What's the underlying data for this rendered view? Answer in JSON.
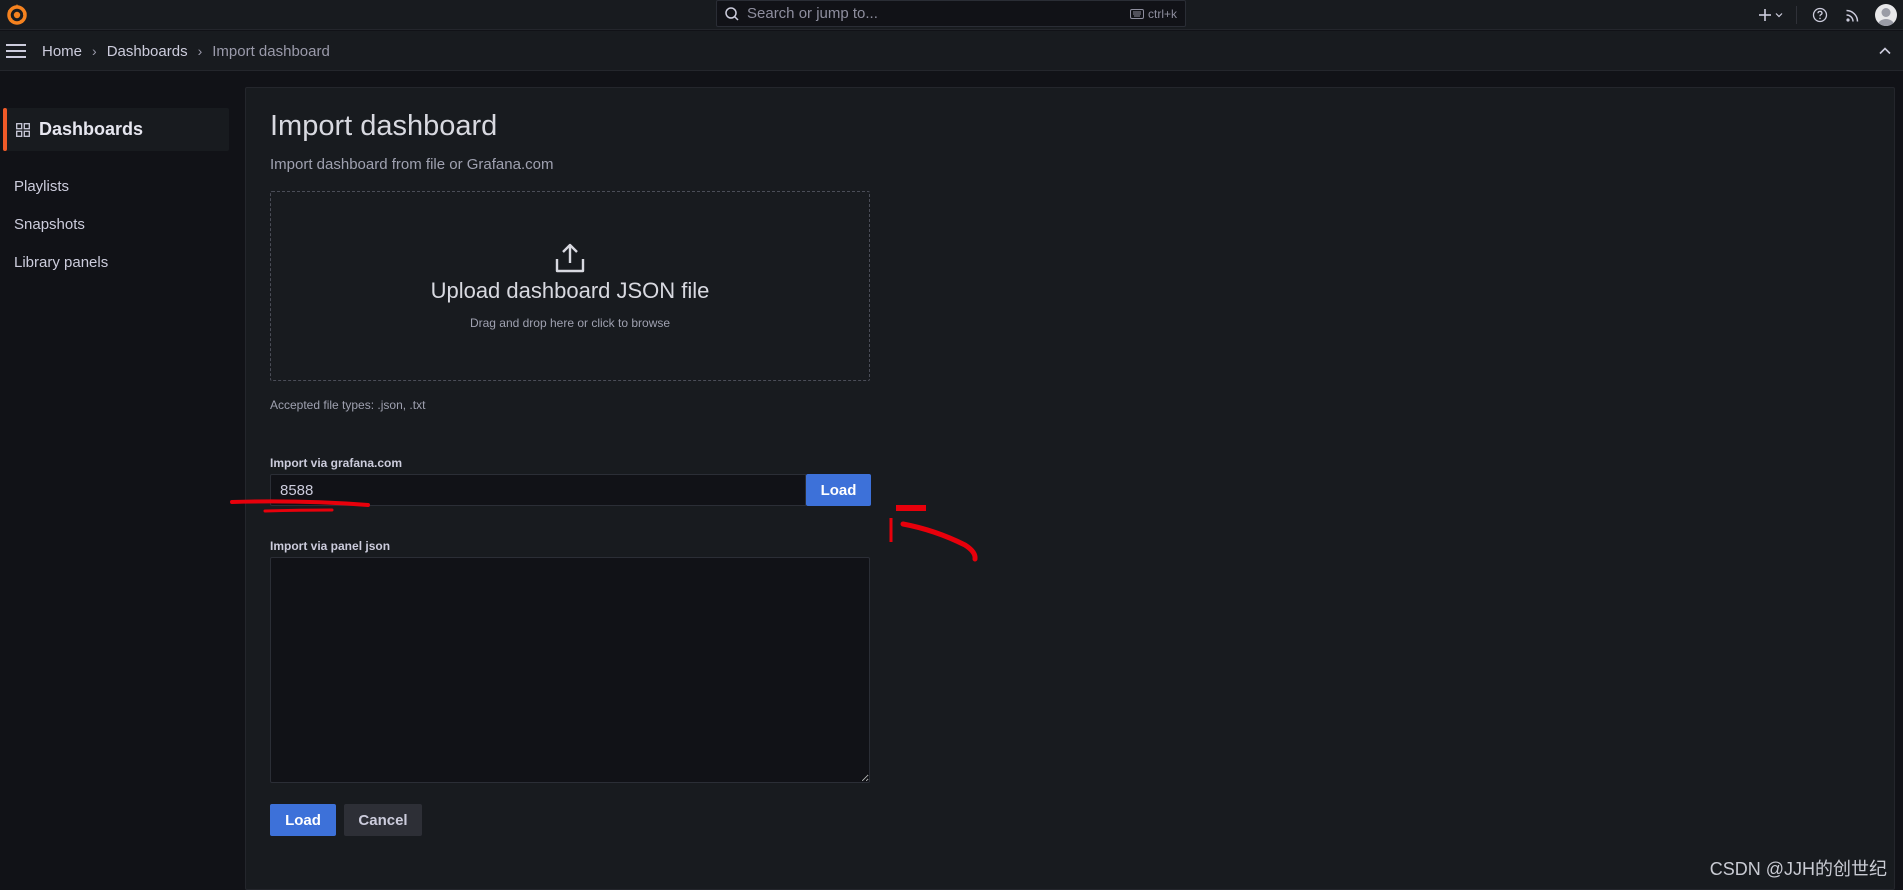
{
  "search": {
    "placeholder": "Search or jump to...",
    "shortcut": "ctrl+k"
  },
  "breadcrumb": {
    "items": [
      "Home",
      "Dashboards",
      "Import dashboard"
    ]
  },
  "sidebar": {
    "section_title": "Dashboards",
    "items": [
      "Playlists",
      "Snapshots",
      "Library panels"
    ]
  },
  "page": {
    "title": "Import dashboard",
    "subtitle": "Import dashboard from file or Grafana.com",
    "upload": {
      "title": "Upload dashboard JSON file",
      "hint": "Drag and drop here or click to browse",
      "accepted": "Accepted file types: .json, .txt"
    },
    "grafana_com": {
      "label": "Import via grafana.com",
      "value": "8588",
      "load_label": "Load"
    },
    "panel_json": {
      "label": "Import via panel json",
      "value": ""
    },
    "actions": {
      "load_label": "Load",
      "cancel_label": "Cancel"
    }
  },
  "watermark": "CSDN @JJH的创世纪",
  "colors": {
    "accent": "#f05a28",
    "primary_button": "#3d71d9",
    "annotation": "#e8000b"
  }
}
